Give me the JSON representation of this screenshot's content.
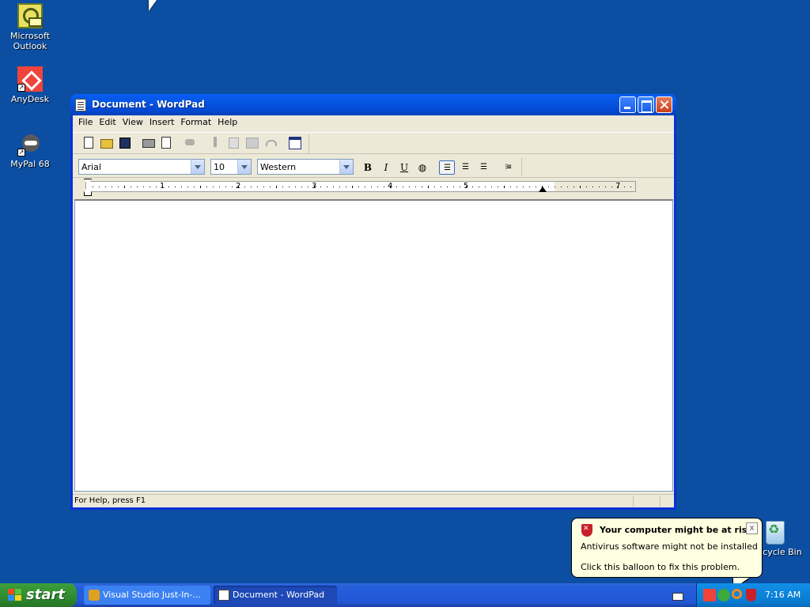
{
  "desktop": {
    "icons": [
      {
        "label_line1": "Microsoft",
        "label_line2": "Outlook",
        "icon": "outlook-icon"
      },
      {
        "label_line1": "AnyDesk",
        "label_line2": "",
        "icon": "anydesk-icon"
      },
      {
        "label_line1": "MyPal 68",
        "label_line2": "",
        "icon": "mypal-icon"
      },
      {
        "label_line1": "Recycle Bin",
        "label_line2": "",
        "icon": "recycle-bin-icon"
      }
    ]
  },
  "window": {
    "title": "Document - WordPad",
    "menu": [
      "File",
      "Edit",
      "View",
      "Insert",
      "Format",
      "Help"
    ],
    "toolbar_icons": [
      "new-icon",
      "open-icon",
      "save-icon",
      "print-icon",
      "print-preview-icon",
      "find-icon",
      "cut-icon",
      "copy-icon",
      "paste-icon",
      "undo-icon",
      "date-time-icon"
    ],
    "format": {
      "font": "Arial",
      "size": "10",
      "script": "Western",
      "bold": "B",
      "italic": "I",
      "underline": "U"
    },
    "ruler_numbers": [
      "1",
      "2",
      "3",
      "4",
      "5",
      "7"
    ],
    "status": "For Help, press F1"
  },
  "taskbar": {
    "start_label": "start",
    "tasks": [
      {
        "label": "Visual Studio Just-In-...",
        "active": false
      },
      {
        "label": "Document - WordPad",
        "active": true
      }
    ],
    "clock": "7:16 AM"
  },
  "balloon": {
    "title": "Your computer might be at risk",
    "line1": "Antivirus software might not be installed",
    "line2": "Click this balloon to fix this problem.",
    "close": "x"
  },
  "colors": {
    "desktop": "#0b4ea2",
    "title_bar": "#0a5ef4",
    "start_button": "#2f8a2f",
    "tray": "#0f8ae2",
    "balloon": "#ffffe1"
  }
}
